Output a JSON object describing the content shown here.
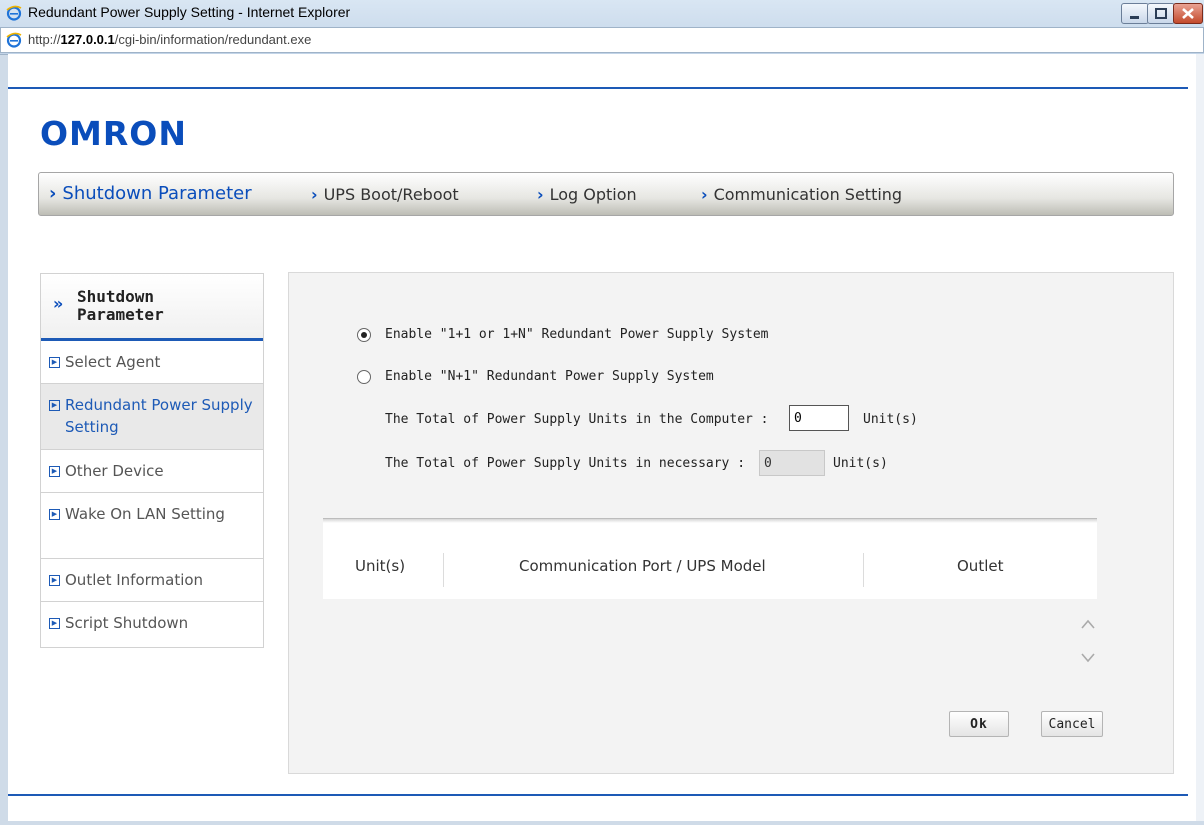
{
  "window": {
    "title": "Redundant Power Supply Setting - Internet Explorer",
    "address_prefix": "http://",
    "address_host": "127.0.0.1",
    "address_path": "/cgi-bin/information/redundant.exe"
  },
  "brand": {
    "logo": "OMRON",
    "color": "#0a4dbb"
  },
  "top_nav": [
    {
      "label": "Shutdown Parameter",
      "active": true
    },
    {
      "label": "UPS Boot/Reboot"
    },
    {
      "label": "Log Option"
    },
    {
      "label": "Communication Setting"
    }
  ],
  "sidebar": {
    "header": "Shutdown Parameter",
    "items": [
      {
        "label": "Select Agent"
      },
      {
        "label": "Redundant Power Supply Setting",
        "active": true
      },
      {
        "label": "Other Device"
      },
      {
        "label": "Wake On LAN Setting"
      },
      {
        "label": "Outlet Information"
      },
      {
        "label": "Script Shutdown"
      }
    ]
  },
  "form": {
    "option1_label": "Enable \"1+1 or 1+N\" Redundant Power Supply System",
    "option1_selected": true,
    "option2_label": "Enable \"N+1\" Redundant Power Supply System",
    "option2_selected": false,
    "total_label": "The Total of Power Supply Units in the Computer :",
    "total_value": "0",
    "total_unit": "Unit(s)",
    "necessary_label": "The Total of Power Supply Units in necessary :",
    "necessary_value": "0",
    "necessary_unit": "Unit(s)"
  },
  "table": {
    "headers": [
      "Unit(s)",
      "Communication Port / UPS Model",
      "Outlet"
    ],
    "rows": []
  },
  "buttons": {
    "ok": "Ok",
    "cancel": "Cancel"
  }
}
